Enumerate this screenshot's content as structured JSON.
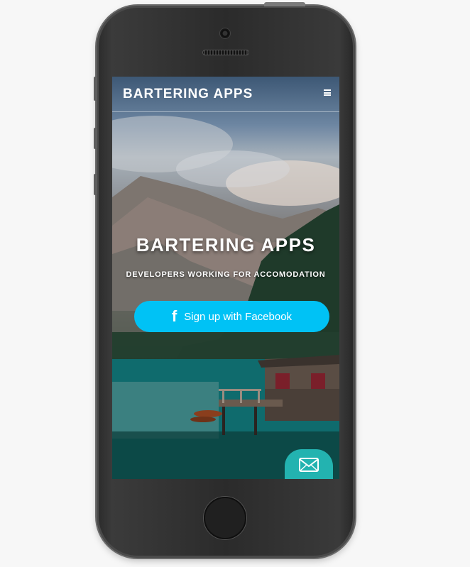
{
  "navbar": {
    "brand": "BARTERING APPS",
    "menu_icon": "hamburger-menu-icon"
  },
  "hero": {
    "title": "BARTERING APPS",
    "subtitle": "DEVELOPERS WORKING FOR ACCOMODATION"
  },
  "signup_button": {
    "icon": "facebook-icon",
    "icon_glyph": "f",
    "label": "Sign up with Facebook"
  },
  "contact_button": {
    "icon": "envelope-icon"
  },
  "colors": {
    "facebook_button": "#00c2f5",
    "contact_button": "#23b3b0",
    "phone_body": "#2b2b2b"
  }
}
